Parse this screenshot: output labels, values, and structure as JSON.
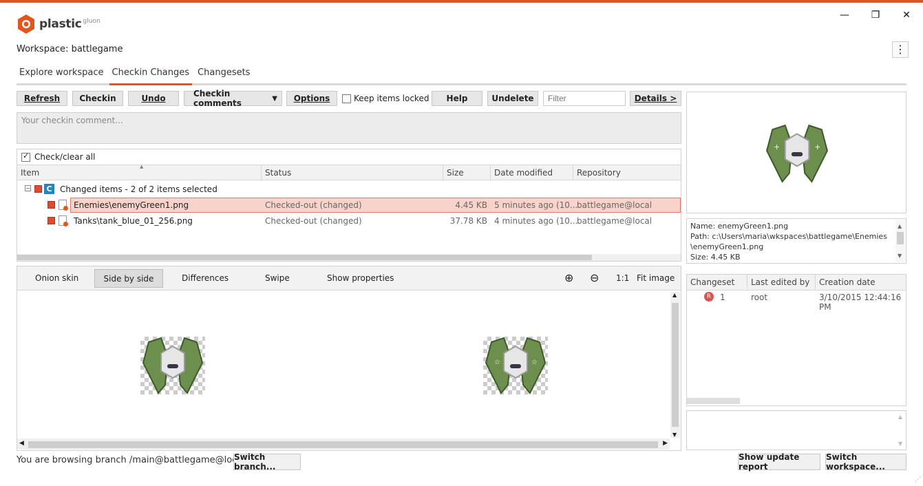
{
  "app": {
    "brand": "plastic",
    "brand_sup": "gluon",
    "accent": "#e2561e"
  },
  "window": {
    "minimize": "—",
    "restore": "❐",
    "close": "✕"
  },
  "workspace_label": "Workspace: battlegame",
  "tabs": [
    "Explore workspace",
    "Checkin Changes",
    "Changesets"
  ],
  "toolbar": {
    "refresh": "Refresh",
    "checkin": "Checkin",
    "undo": "Undo",
    "checkin_comments": "Checkin comments",
    "options": "Options",
    "keep_locked": "Keep items locked",
    "help": "Help",
    "undelete": "Undelete",
    "filter_placeholder": "Filter",
    "details": "Details >"
  },
  "comment_placeholder": "Your checkin comment...",
  "check_all": "Check/clear all",
  "columns": [
    "Item",
    "Status",
    "Size",
    "Date modified",
    "Repository"
  ],
  "group_label": "Changed items - 2 of 2 items selected",
  "group_badge": "C",
  "rows": [
    {
      "item": "Enemies\\enemyGreen1.png",
      "status": "Checked-out (changed)",
      "size": "4.45 KB",
      "date": "5 minutes ago (10...",
      "repo": "battlegame@local"
    },
    {
      "item": "Tanks\\tank_blue_01_256.png",
      "status": "Checked-out (changed)",
      "size": "37.78 KB",
      "date": "4 minutes ago (10...",
      "repo": "battlegame@local"
    }
  ],
  "diff_modes": [
    "Onion skin",
    "Side by side",
    "Differences",
    "Swipe",
    "Show properties"
  ],
  "zoom": {
    "in": "⊕",
    "out": "⊖",
    "one": "1:1",
    "fit": "Fit image"
  },
  "info": {
    "name": "Name: enemyGreen1.png",
    "path1": "Path: c:\\Users\\maria\\wkspaces\\battlegame\\Enemies",
    "path2": "\\enemyGreen1.png",
    "size": "Size: 4.45 KB"
  },
  "history": {
    "columns": [
      "Changeset",
      "Last edited by",
      "Creation date"
    ],
    "rows": [
      {
        "badge": "R",
        "changeset": "1",
        "user": "root",
        "date": "3/10/2015 12:44:16 PM"
      }
    ]
  },
  "status_text": "You are browsing branch /main@battlegame@local",
  "switch_branch": "Switch branch...",
  "show_update_report": "Show update report",
  "switch_workspace": "Switch workspace..."
}
